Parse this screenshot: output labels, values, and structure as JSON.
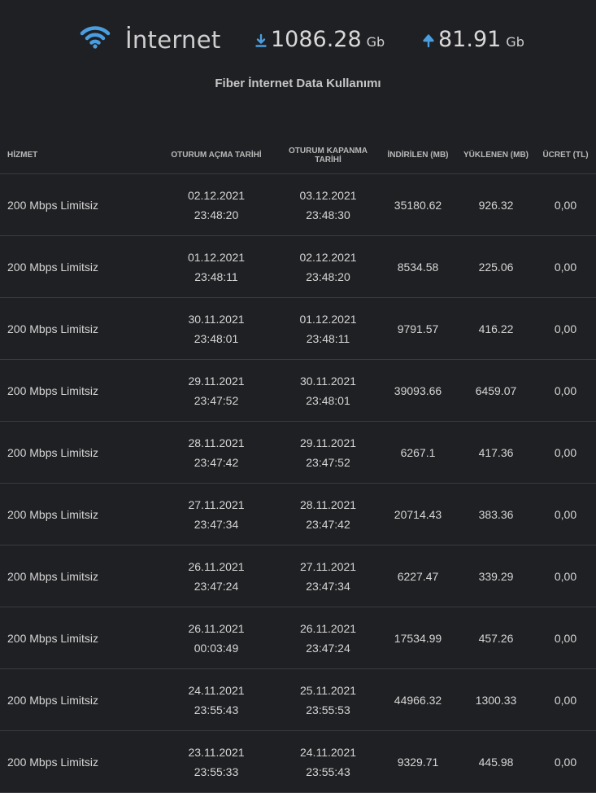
{
  "header": {
    "title": "İnternet",
    "download": {
      "value": "1086.28",
      "unit": "Gb"
    },
    "upload": {
      "value": "81.91",
      "unit": "Gb"
    },
    "subtitle": "Fiber İnternet Data Kullanımı"
  },
  "colors": {
    "accent": "#4a9ee0",
    "background": "#1f2023"
  },
  "icons": {
    "title": "wifi-icon",
    "download": "download-arrow-icon",
    "upload": "upload-arrow-icon"
  },
  "table": {
    "columns": {
      "service": "HİZMET",
      "open_line1": "OTURUM AÇMA TARİHİ",
      "close_line1": "OTURUM KAPANMA",
      "close_line2": "TARİHİ",
      "downloaded": "İNDİRİLEN (MB)",
      "uploaded": "YÜKLENEN (MB)",
      "fee": "ÜCRET (TL)"
    },
    "rows": [
      {
        "service": "200 Mbps Limitsiz",
        "open_date": "02.12.2021",
        "open_time": "23:48:20",
        "close_date": "03.12.2021",
        "close_time": "23:48:30",
        "downloaded": "35180.62",
        "uploaded": "926.32",
        "fee": "0,00"
      },
      {
        "service": "200 Mbps Limitsiz",
        "open_date": "01.12.2021",
        "open_time": "23:48:11",
        "close_date": "02.12.2021",
        "close_time": "23:48:20",
        "downloaded": "8534.58",
        "uploaded": "225.06",
        "fee": "0,00"
      },
      {
        "service": "200 Mbps Limitsiz",
        "open_date": "30.11.2021",
        "open_time": "23:48:01",
        "close_date": "01.12.2021",
        "close_time": "23:48:11",
        "downloaded": "9791.57",
        "uploaded": "416.22",
        "fee": "0,00"
      },
      {
        "service": "200 Mbps Limitsiz",
        "open_date": "29.11.2021",
        "open_time": "23:47:52",
        "close_date": "30.11.2021",
        "close_time": "23:48:01",
        "downloaded": "39093.66",
        "uploaded": "6459.07",
        "fee": "0,00"
      },
      {
        "service": "200 Mbps Limitsiz",
        "open_date": "28.11.2021",
        "open_time": "23:47:42",
        "close_date": "29.11.2021",
        "close_time": "23:47:52",
        "downloaded": "6267.1",
        "uploaded": "417.36",
        "fee": "0,00"
      },
      {
        "service": "200 Mbps Limitsiz",
        "open_date": "27.11.2021",
        "open_time": "23:47:34",
        "close_date": "28.11.2021",
        "close_time": "23:47:42",
        "downloaded": "20714.43",
        "uploaded": "383.36",
        "fee": "0,00"
      },
      {
        "service": "200 Mbps Limitsiz",
        "open_date": "26.11.2021",
        "open_time": "23:47:24",
        "close_date": "27.11.2021",
        "close_time": "23:47:34",
        "downloaded": "6227.47",
        "uploaded": "339.29",
        "fee": "0,00"
      },
      {
        "service": "200 Mbps Limitsiz",
        "open_date": "26.11.2021",
        "open_time": "00:03:49",
        "close_date": "26.11.2021",
        "close_time": "23:47:24",
        "downloaded": "17534.99",
        "uploaded": "457.26",
        "fee": "0,00"
      },
      {
        "service": "200 Mbps Limitsiz",
        "open_date": "24.11.2021",
        "open_time": "23:55:43",
        "close_date": "25.11.2021",
        "close_time": "23:55:53",
        "downloaded": "44966.32",
        "uploaded": "1300.33",
        "fee": "0,00"
      },
      {
        "service": "200 Mbps Limitsiz",
        "open_date": "23.11.2021",
        "open_time": "23:55:33",
        "close_date": "24.11.2021",
        "close_time": "23:55:43",
        "downloaded": "9329.71",
        "uploaded": "445.98",
        "fee": "0,00"
      }
    ]
  }
}
